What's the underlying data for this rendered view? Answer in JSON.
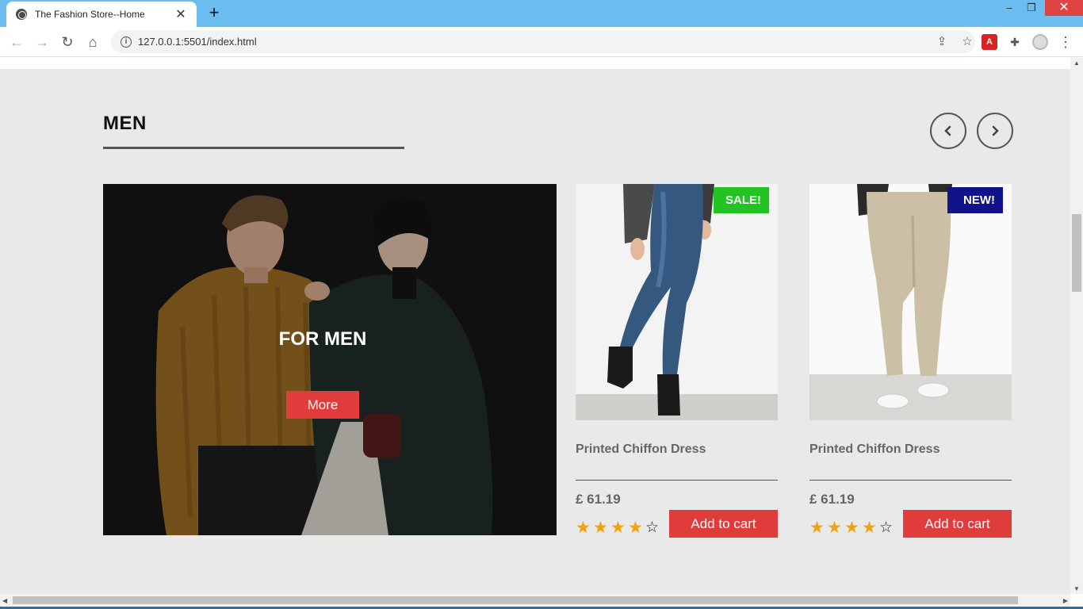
{
  "browser": {
    "tab_title": "The Fashion Store--Home",
    "tab_close": "✕",
    "new_tab": "+",
    "url": "127.0.0.1:5501/index.html",
    "window_controls": {
      "minimize": "–",
      "restore": "❐",
      "close": "✕"
    },
    "nav": {
      "back": "←",
      "forward": "→",
      "reload": "↻",
      "home": "⌂"
    },
    "icons": [
      "share-icon",
      "star-icon",
      "pdf-extension-icon",
      "puzzle-extension-icon",
      "profile-avatar-icon",
      "kebab-menu-icon"
    ],
    "pdf_label": "A",
    "menu_glyph": "⋮"
  },
  "section": {
    "title": "MEN",
    "prev_label": "previous",
    "next_label": "next",
    "underline_color": "#555555"
  },
  "banner": {
    "title": "FOR MEN",
    "button": "More",
    "accent": "#e03c3c"
  },
  "products": [
    {
      "badge": "SALE!",
      "badge_color": "#22c322",
      "name": "Printed Chiffon Dress",
      "price": "£ 61.19",
      "rating": 4,
      "rating_max": 5,
      "cart_label": "Add to cart"
    },
    {
      "badge": "NEW!",
      "badge_color": "#12128a",
      "name": "Printed Chiffon Dress",
      "price": "£ 61.19",
      "rating": 4,
      "rating_max": 5,
      "cart_label": "Add to cart"
    }
  ]
}
